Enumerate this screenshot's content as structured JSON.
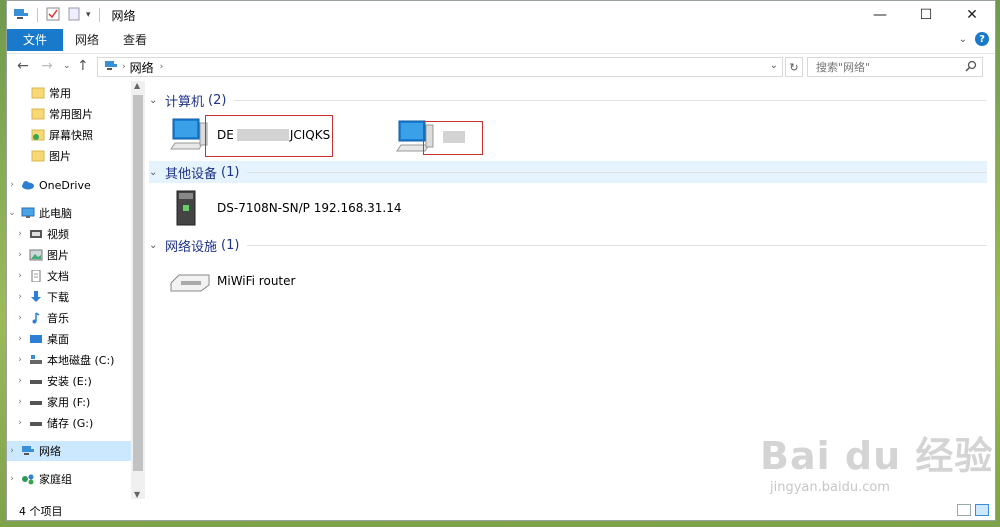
{
  "window": {
    "title": "网络"
  },
  "ribbon": {
    "tabs": [
      "文件",
      "网络",
      "查看"
    ]
  },
  "address": {
    "breadcrumb": "网络",
    "search_placeholder": "搜索\"网络\""
  },
  "nav": {
    "items": [
      {
        "label": "常用",
        "icon": "folder-icon"
      },
      {
        "label": "常用图片",
        "icon": "folder-icon"
      },
      {
        "label": "屏幕快照",
        "icon": "folder-check-icon"
      },
      {
        "label": "图片",
        "icon": "folder-icon"
      },
      {
        "label": "OneDrive",
        "icon": "cloud-icon"
      },
      {
        "label": "此电脑",
        "icon": "computer-icon"
      },
      {
        "label": "视频",
        "icon": "video-icon"
      },
      {
        "label": "图片",
        "icon": "pictures-icon"
      },
      {
        "label": "文档",
        "icon": "document-icon"
      },
      {
        "label": "下载",
        "icon": "download-icon"
      },
      {
        "label": "音乐",
        "icon": "music-icon"
      },
      {
        "label": "桌面",
        "icon": "desktop-icon"
      },
      {
        "label": "本地磁盘 (C:)",
        "icon": "drive-icon"
      },
      {
        "label": "安装 (E:)",
        "icon": "drive-icon"
      },
      {
        "label": "家用 (F:)",
        "icon": "drive-icon"
      },
      {
        "label": "储存 (G:)",
        "icon": "drive-icon"
      },
      {
        "label": "网络",
        "icon": "network-icon"
      },
      {
        "label": "家庭组",
        "icon": "homegroup-icon"
      }
    ]
  },
  "groups": [
    {
      "title": "计算机",
      "count": "(2)"
    },
    {
      "title": "其他设备",
      "count": "(1)"
    },
    {
      "title": "网络设施",
      "count": "(1)"
    }
  ],
  "items": {
    "computer1": "DE",
    "computer1_suffix": "JCIQKS",
    "device": "DS-7108N-SN/P 192.168.31.14",
    "router": "MiWiFi router"
  },
  "status": {
    "count": "4 个项目"
  },
  "watermark": {
    "brand": "Bai du 经验",
    "url": "jingyan.baidu.com"
  },
  "colors": {
    "accent": "#1979ca",
    "selected": "#cce8ff",
    "group_text": "#1e3287"
  }
}
